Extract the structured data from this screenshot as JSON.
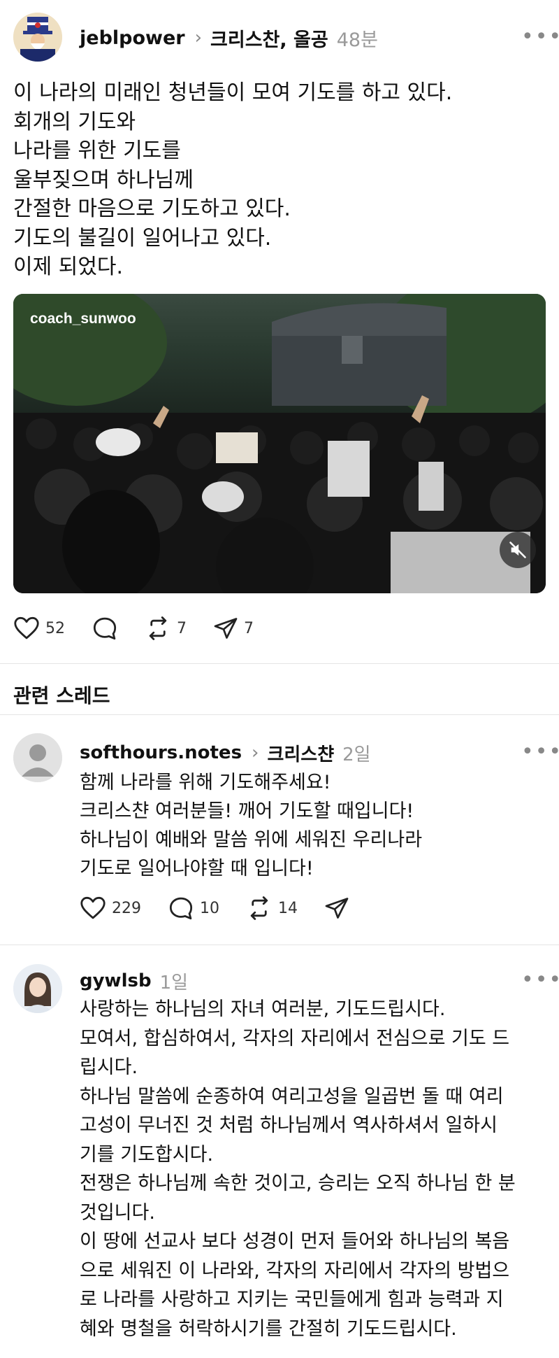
{
  "main_post": {
    "username": "jeblpower",
    "topic": "크리스찬, 올공",
    "time": "48분",
    "lines": [
      "이 나라의 미래인 청년들이 모여 기도를 하고 있다.",
      "회개의 기도와",
      "나라를 위한 기도를",
      "울부짖으며 하나님께",
      "간절한 마음으로 기도하고 있다.",
      "기도의 불길이 일어나고 있다.",
      "이제 되었다."
    ],
    "video_watermark": "coach_sunwoo",
    "likes": "52",
    "reposts": "7",
    "shares": "7"
  },
  "related": {
    "title": "관련 스레드",
    "posts": [
      {
        "username": "softhours.notes",
        "topic": "크리스챤",
        "time": "2일",
        "lines": [
          "함께 나라를 위해 기도해주세요!",
          "크리스챤 여러분들! 깨어 기도할 때입니다!",
          "하나님이 예배와 말씀 위에 세워진 우리나라",
          "기도로 일어나야할 때 입니다!"
        ],
        "likes": "229",
        "comments": "10",
        "reposts": "14"
      },
      {
        "username": "gywlsb",
        "time": "1일",
        "lines": [
          "사랑하는 하나님의 자녀 여러분, 기도드립시다.",
          "모여서, 합심하여서, 각자의 자리에서 전심으로 기도 드",
          "립시다.",
          "하나님 말씀에 순종하여 여리고성을 일곱번 돌 때 여리",
          "고성이 무너진 것 처럼 하나님께서 역사하셔서 일하시",
          "기를 기도합시다.",
          "전쟁은 하나님께 속한 것이고, 승리는 오직 하나님 한 분",
          "것입니다.",
          "이 땅에 선교사 보다 성경이 먼저 들어와 하나님의 복음",
          "으로 세워진 이 나라와, 각자의 자리에서 각자의 방법으",
          "로 나라를 사랑하고 지키는 국민들에게 힘과 능력과 지",
          "혜와 명철을 허락하시기를 간절히 기도드립시다."
        ]
      }
    ]
  },
  "icons": {
    "heart": "heart-icon",
    "comment": "comment-icon",
    "repost": "repost-icon",
    "share": "share-icon",
    "more": "more-icon",
    "mute": "mute-icon"
  }
}
